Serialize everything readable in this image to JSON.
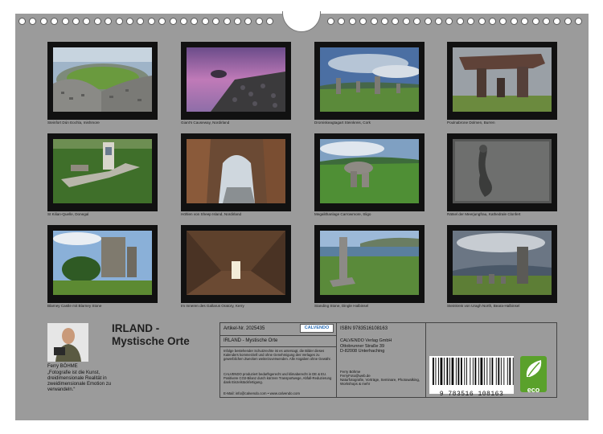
{
  "photos": [
    {
      "caption": "Steinfort Dún Eochla, Inishmore"
    },
    {
      "caption": "Giant's Causeway, Nordirland"
    },
    {
      "caption": "Dromiskeagtagart Steinkreis, Cork"
    },
    {
      "caption": "Poulnabrone Dolmen, Burren"
    },
    {
      "caption": "St Kilian-Quelle, Donegal"
    },
    {
      "caption": "Höhlen von Sheep Island, Nordirland"
    },
    {
      "caption": "Megalithanlage Carrowmore, Sligo"
    },
    {
      "caption": "Rätsel der Meerjungfrau, Kathedrale Clonfert"
    },
    {
      "caption": "Blarney Castle mit Blarney Stone"
    },
    {
      "caption": "Im Inneren des Gallarus Oratory, Kerry"
    },
    {
      "caption": "Standing Stone, Dingle Halbinsel"
    },
    {
      "caption": "Steinkreis von Uragh North, Beara-Halbinsel"
    }
  ],
  "title": {
    "line1": "IRLAND -",
    "line2": "Mystische Orte"
  },
  "author": {
    "name": "Ferry BÖHME",
    "quote": "„Fotografie ist die Kunst, dreidimensionale Realität in zweidimensionale Emotion zu verwandeln.“"
  },
  "info": {
    "article": "Artikel-Nr. 2025435",
    "logo": "CALVENDO",
    "product_title": "IRLAND - Mystische Orte",
    "legal": "Infolge bestehender Schutzrechte ist es untersagt, die Bilder dieses Kalenders kommerziell und ohne Genehmigung des Verlages zu gewerblichen Zwecken weiterzuverwenden. Alle Angaben ohne Gewähr.",
    "production": "CALVENDO produziert bedarfsgerecht und klimaberecht in DE & EU. Positivere CO2-Bilanz durch kürzere Transportwege, Abfall-Reduzierung dank Einzelstückfertigung.",
    "contact": "E-Mail: info@calvendo.com • www.calvendo.com",
    "isbn": "ISBN 9783516108163",
    "publisher": [
      "CALVENDO Verlag GmbH",
      "Ottobrunner Straße 39",
      "D-82008 Unterhaching"
    ],
    "photographer": [
      "Ferry Böhme",
      "FerryFoto@web.de",
      "Naturfotografie, Vorträge, Seminare, Photowalking, Workshops & mehr"
    ],
    "barcode_digits": "9 783516 108163",
    "eco_label": "eco"
  },
  "colors": {
    "background": "#9b9b9b",
    "frame": "#111111",
    "eco": "#5aa12b"
  }
}
